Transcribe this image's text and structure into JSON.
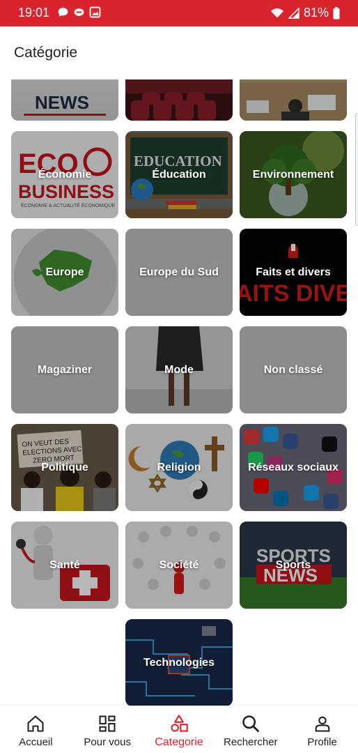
{
  "status_bar": {
    "time": "19:01",
    "battery": "81%",
    "icons_left": [
      "chat-bubble-icon",
      "message-icon",
      "gallery-icon"
    ],
    "icons_right": [
      "wifi-icon",
      "signal-icon",
      "battery-icon"
    ],
    "color": "#d9232d"
  },
  "header": {
    "title": "Catégorie"
  },
  "partial_row": [
    {
      "label": "",
      "image": "news"
    },
    {
      "label": "",
      "image": "cinema"
    },
    {
      "label": "",
      "image": "office"
    }
  ],
  "categories": [
    {
      "label": "Économie",
      "image": "eco-business-logo",
      "logo_text": "ECO BUSINESS"
    },
    {
      "label": "Éducation",
      "image": "chalkboard-education",
      "logo_text": "EDUCATION"
    },
    {
      "label": "Environnement",
      "image": "tree-on-globe"
    },
    {
      "label": "Europe",
      "image": "europe-globe"
    },
    {
      "label": "Europe du Sud",
      "image": "gray"
    },
    {
      "label": "Faits et divers",
      "image": "faits-divers-banner",
      "logo_text": "FAITS DIVERS"
    },
    {
      "label": "Magaziner",
      "image": "gray"
    },
    {
      "label": "Mode",
      "image": "fashion-model"
    },
    {
      "label": "Non classé",
      "image": "gray"
    },
    {
      "label": "Politique",
      "image": "protest-crowd",
      "logo_text": "ON VEUT DES ELECTIONS AVEC ZERO MORT"
    },
    {
      "label": "Religion",
      "image": "religious-symbols"
    },
    {
      "label": "Réseaux sociaux",
      "image": "social-media-icons"
    },
    {
      "label": "Santé",
      "image": "doctor-figure"
    },
    {
      "label": "Société",
      "image": "people-circle"
    },
    {
      "label": "Sports",
      "image": "sports-news-stadium",
      "logo_text": "SPORTS NEWS"
    },
    {
      "label": "Technologies",
      "image": "circuit-board"
    }
  ],
  "bottom_nav": [
    {
      "label": "Accueil",
      "icon": "home-icon",
      "active": false
    },
    {
      "label": "Pour vous",
      "icon": "grid-icon",
      "active": false
    },
    {
      "label": "Categorie",
      "icon": "shapes-icon",
      "active": true
    },
    {
      "label": "Rechercher",
      "icon": "search-icon",
      "active": false
    },
    {
      "label": "Profile",
      "icon": "user-icon",
      "active": false
    }
  ],
  "accent_color": "#d9232d"
}
